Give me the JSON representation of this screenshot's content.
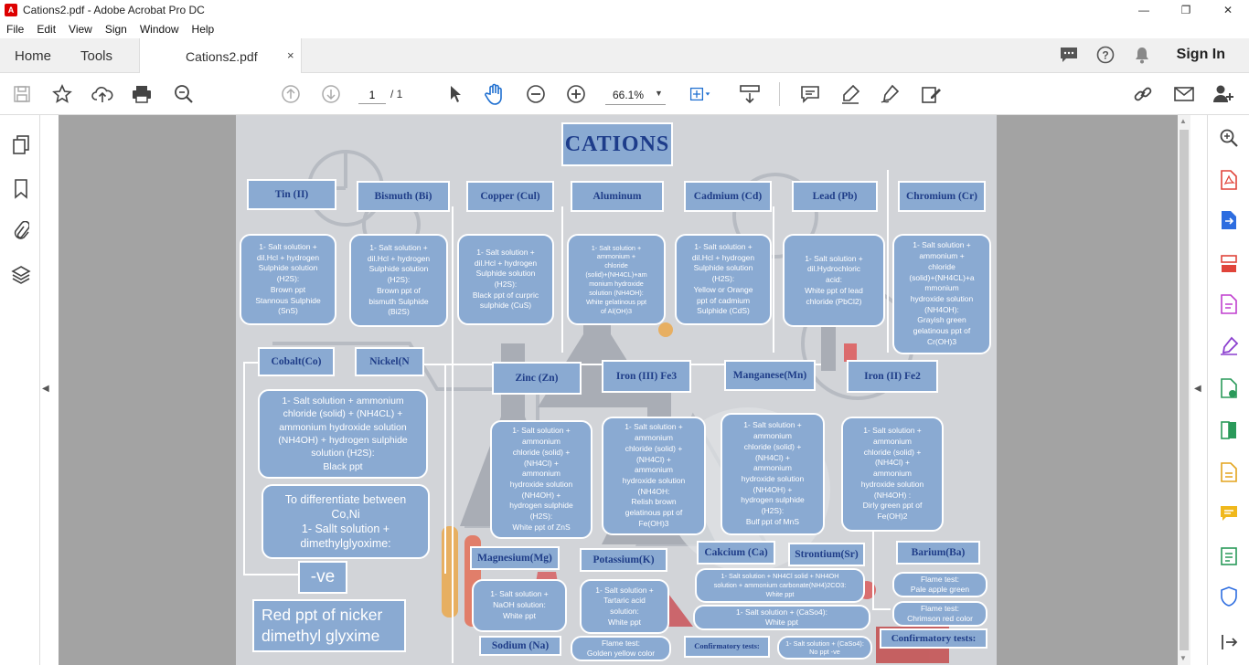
{
  "window": {
    "title": "Cations2.pdf - Adobe Acrobat Pro DC",
    "min": "—",
    "max": "❐",
    "close": "✕"
  },
  "menu": [
    "File",
    "Edit",
    "View",
    "Sign",
    "Window",
    "Help"
  ],
  "tabs": {
    "home": "Home",
    "tools": "Tools",
    "doc": "Cations2.pdf",
    "close": "×",
    "signin": "Sign In"
  },
  "toolbar": {
    "page_current": "1",
    "page_total": "/ 1",
    "zoom": "66.1%",
    "zoom_caret": "▼"
  },
  "poster": {
    "title": "CATIONS",
    "labels": {
      "tin": "Tin (II)",
      "bismuth": "Bismuth (Bi)",
      "copper": "Copper (Cul)",
      "aluminum": "Aluminum",
      "cadmium": "Cadmium (Cd)",
      "lead": "Lead (Pb)",
      "chromium": "Chromium (Cr)",
      "cobalt": "Cobalt(Co)",
      "nickel": "Nickel(N",
      "zinc": "Zinc (Zn)",
      "iron3": "Iron (III) Fe3",
      "manganese": "Manganese(Mn)",
      "iron2": "Iron (II) Fe2",
      "magnesium": "Magnesium(Mg)",
      "potassium": "Potassium(K)",
      "calcium": "Cakcium  (Ca)",
      "strontium": "Strontium(Sr)",
      "barium": "Barium(Ba)",
      "sodium": "Sodium  (Na)",
      "confirm_left": "Confirmatory tests:",
      "confirm_right": "Confirmatory tests:"
    },
    "boxes": {
      "tin": "1- Salt solution +\ndil.Hcl + hydrogen\nSulphide solution\n(H2S):\nBrown ppt\nStannous Sulphide\n(SnS)",
      "bismuth": "1- Salt solution +\ndil.Hcl + hydrogen\nSulphide solution\n(H2S):\nBrown ppt of\nbismuth Sulphide\n(Bi2S)",
      "copper": "1- Salt solution +\ndil.Hcl + hydrogen\nSulphide solution\n(H2S):\nBlack ppt of curpric\nsulphide (CuS)",
      "aluminum": "1- Salt solution +\nammonium +\nchloride\n(solid)+(NH4CL)+am\nmonium hydroxide\nsolution (NH4OH):\nWhite gelatinous ppt\nof Al(OH)3",
      "cadmium": "1- Salt solution +\ndil.Hcl + hydrogen\nSulphide solution\n(H2S):\nYellow or Orange\nppt of cadmium\nSulphide (CdS)",
      "lead": "1- Salt solution +\ndil.Hydrochloric\nacid:\nWhite ppt of lead\nchloride (PbCl2)",
      "chromium": "1- Salt solution +\nammonium +\nchloride\n(solid)+(NH4CL)+a\nmmonium\nhydroxide solution\n(NH4OH):\nGrayish green\ngelatinous ppt of\nCr(OH)3",
      "cobalt": "1- Salt solution + ammonium\nchloride (solid) + (NH4CL) +\nammonium hydroxide solution\n(NH4OH) + hydrogen sulphide\nsolution (H2S):\nBlack ppt",
      "differentiate": "To differentiate between\nCo,Ni\n1- Sallt solution +\ndimethylglyoxime:",
      "zinc": "1- Salt solution +\nammonium\nchloride (solid) +\n(NH4Cl) +\nammonium\nhydroxide solution\n(NH4OH) +\nhydrogen sulphide\n(H2S):\nWhite ppt of ZnS",
      "iron3": "1- Salt solution +\nammonium\nchloride (solid) +\n(NH4Cl) +\nammonium\nhydroxide solution\n(NH4OH:\nRelish brown\ngelatinous ppt of\nFe(OH)3",
      "manganese": "1- Salt solution +\nammonium\nchloride (solid) +\n(NH4Cl) +\nammonium\nhydroxide solution\n(NH4OH) +\nhydrogen sulphide\n(H2S):\nBulf ppt of MnS",
      "iron2": "1- Salt solution +\nammonium\nchloride (solid) +\n(NH4Cl) +\nammonium\nhydroxide solution\n(NH4OH) :\nDirly green ppt of\nFe(OH)2",
      "magnesium": "1- Salt solution +\nNaOH solution:\nWhite ppt",
      "potassium": "1- Salt solution +\nTartaric acid\nsolution:\nWhite ppt",
      "calcium": "1- Salt solution + NH4Cl solid + NH4OH\nsolution + ammonium carbonate(NH4)2CO3:\nWhite ppt",
      "calcium2": "1- Salt solution + (CaSo4):\nWhite ppt",
      "strontium": "1- Salt solution + (CaSo4):\nNo ppt -ve",
      "barium_flame": "Flame test:\nPale apple green",
      "barium_crimson": "Flame test:\nChrimson red color",
      "sodium": "Flame test:\nGolden yellow color",
      "neg": "-ve",
      "nickel_result": "Red ppt of nicker\ndimethyl glyxime"
    }
  }
}
